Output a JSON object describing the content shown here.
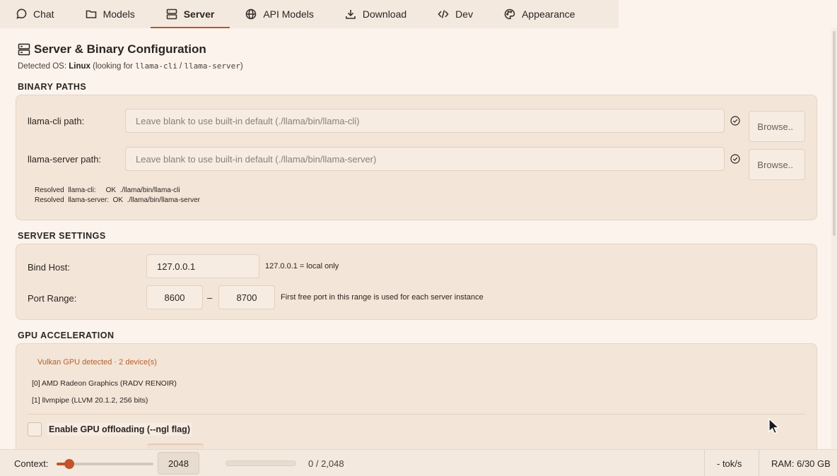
{
  "tabs": [
    {
      "label": "Chat",
      "icon": "chat-icon"
    },
    {
      "label": "Models",
      "icon": "folder-icon"
    },
    {
      "label": "Server",
      "icon": "server-icon",
      "active": true
    },
    {
      "label": "API Models",
      "icon": "globe-icon"
    },
    {
      "label": "Download",
      "icon": "download-icon"
    },
    {
      "label": "Dev",
      "icon": "code-icon"
    },
    {
      "label": "Appearance",
      "icon": "palette-icon"
    }
  ],
  "header": {
    "title": "Server & Binary Configuration",
    "detected_prefix": "Detected OS:",
    "os": "Linux",
    "looking_for": "(looking for",
    "bin1": "llama-cli",
    "slash": "/",
    "bin2": "llama-server",
    "close_paren": ")"
  },
  "binary_paths": {
    "heading": "BINARY PATHS",
    "cli_label": "llama-cli path:",
    "cli_placeholder": "Leave blank to use built-in default  (./llama/bin/llama-cli)",
    "server_label": "llama-server path:",
    "server_placeholder": "Leave blank to use built-in default  (./llama/bin/llama-server)",
    "browse_label": "Browse..",
    "resolved_cli": "Resolved  llama-cli:     OK  ./llama/bin/llama-cli",
    "resolved_server": "Resolved  llama-server:  OK  ./llama/bin/llama-server"
  },
  "server_settings": {
    "heading": "SERVER SETTINGS",
    "bind_label": "Bind Host:",
    "bind_value": "127.0.0.1",
    "bind_hint": "127.0.0.1 = local only",
    "port_label": "Port Range:",
    "port_from": "8600",
    "port_sep": "–",
    "port_to": "8700",
    "port_hint": "First free port in this range is used for each server instance"
  },
  "gpu": {
    "heading": "GPU ACCELERATION",
    "status": "Vulkan GPU detected  ·  2 device(s)",
    "devices": [
      "[0]  AMD Radeon Graphics (RADV RENOIR)",
      "[1]  llvmpipe (LLVM 20.1.2, 256 bits)"
    ],
    "offload_label": "Enable GPU offloading  (--ngl flag)",
    "offload_checked": false,
    "status_color": "#b8602c"
  },
  "statusbar": {
    "context_label": "Context:",
    "context_value": "2048",
    "slider_fraction": 0.09,
    "usage_text": "0 / 2,048",
    "usage_fraction": 0,
    "speed": "- tok/s",
    "ram": "RAM: 6/30 GB"
  },
  "colors": {
    "accent": "#c2532a",
    "background": "#fbf3ec",
    "panel": "#f3e5d8"
  }
}
